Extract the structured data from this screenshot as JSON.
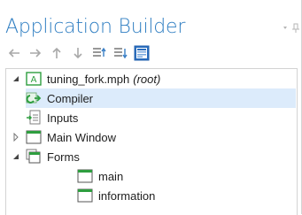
{
  "panel": {
    "title": "Application Builder"
  },
  "toolbar": {
    "buttons": [
      {
        "name": "back-arrow-icon"
      },
      {
        "name": "forward-arrow-icon"
      },
      {
        "name": "move-up-icon"
      },
      {
        "name": "move-down-icon"
      },
      {
        "name": "collapse-list-icon"
      },
      {
        "name": "expand-list-icon"
      },
      {
        "name": "show-tree-icon",
        "active": true
      }
    ]
  },
  "tree": {
    "root": {
      "label": "tuning_fork.mph",
      "note": "(root)",
      "badge": "A"
    },
    "items": [
      {
        "label": "Compiler",
        "icon": "compiler-icon",
        "selected": true
      },
      {
        "label": "Inputs",
        "icon": "inputs-icon"
      },
      {
        "label": "Main Window",
        "icon": "window-icon",
        "expander": "collapsed"
      },
      {
        "label": "Forms",
        "icon": "forms-icon",
        "expander": "expanded"
      }
    ],
    "forms": [
      {
        "label": "main",
        "icon": "form-icon"
      },
      {
        "label": "information",
        "icon": "form-icon"
      }
    ]
  },
  "colors": {
    "title": "#2f7ec2",
    "selection": "#dcebfb",
    "accent_green": "#2e9e3f",
    "toolbar_active": "#1f5fae"
  }
}
